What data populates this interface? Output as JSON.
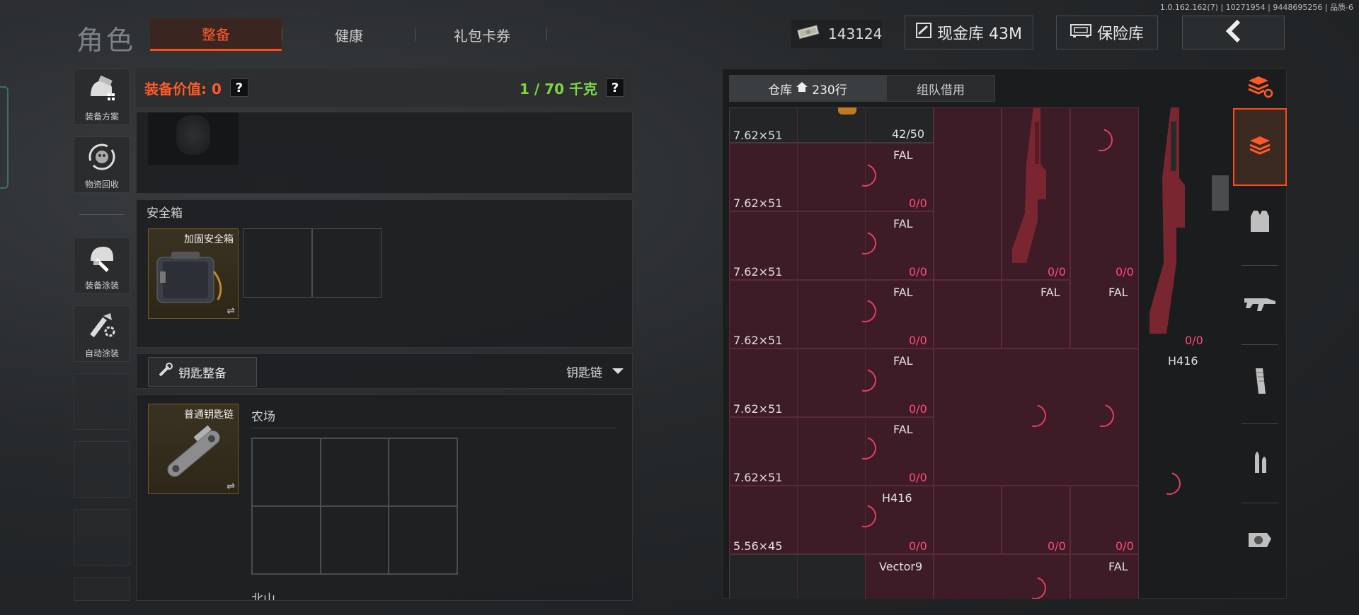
{
  "version": "1.0.162.162(7) | 10271954 | 9448695256 | 品质-6",
  "header": {
    "title": "角色",
    "tabs": [
      {
        "label": "整备",
        "active": true
      },
      {
        "label": "健康",
        "active": false
      },
      {
        "label": "礼包卡券",
        "active": false
      }
    ],
    "money": "143124",
    "cash_vault": "现金库 43M",
    "safe_vault": "保险库"
  },
  "left_menu": [
    {
      "label": "装备方案",
      "icon": "helmet-gear-icon"
    },
    {
      "label": "物资回收",
      "icon": "recycle-icon"
    },
    {
      "label": "装备涂装",
      "icon": "helmet-brush-icon"
    },
    {
      "label": "自动涂装",
      "icon": "auto-paint-icon"
    }
  ],
  "loadout": {
    "value_label": "装备价值: 0",
    "weight_label": "1 / 70 千克",
    "help": "?"
  },
  "safebox": {
    "title": "安全箱",
    "item_name": "加固安全箱",
    "swap": "⇌"
  },
  "keychain": {
    "button_label": "钥匙整备",
    "dropdown_label": "钥匙链",
    "item_name": "普通钥匙链",
    "swap": "⇌",
    "map1": "农场",
    "map2": "北山"
  },
  "warehouse": {
    "tab_storage": "仓库",
    "tab_storage_count": "230行",
    "tab_team": "组队借用",
    "rows": [
      {
        "caliber": "7.62×51",
        "name": "",
        "count": "42/50"
      },
      {
        "caliber": "7.62×51",
        "name": "FAL",
        "count": "0/0"
      },
      {
        "caliber": "7.62×51",
        "name": "FAL",
        "count": "0/0"
      },
      {
        "caliber": "7.62×51",
        "name": "FAL",
        "count": "0/0"
      },
      {
        "caliber": "7.62×51",
        "name": "FAL",
        "count": "0/0"
      },
      {
        "caliber": "7.62×51",
        "name": "FAL",
        "count": "0/0"
      },
      {
        "caliber": "5.56×45",
        "name": "H416",
        "count": "0/0"
      },
      {
        "caliber": "",
        "name": "Vector9",
        "count": ""
      }
    ],
    "extra": {
      "row2_col4_count": "0/0",
      "row2_col5_count": "0/0",
      "row3_col4_name": "FAL",
      "row3_col5_name": "FAL",
      "row3_col6_count": "0/0",
      "row4_col6_name": "H416",
      "row6_col4_count": "0/0",
      "row6_col5_count": "0/0",
      "row7_col5_name": "FAL"
    }
  },
  "categories": [
    "layers-refresh-icon",
    "layers-icon",
    "vest-icon",
    "rifle-icon",
    "magazine-icon",
    "bullet-icon",
    "scope-icon"
  ],
  "colors": {
    "accent": "#ff4a1a",
    "green": "#7bd640",
    "pink_cell": "#3e1c27",
    "count_red": "#ff4a7a"
  }
}
